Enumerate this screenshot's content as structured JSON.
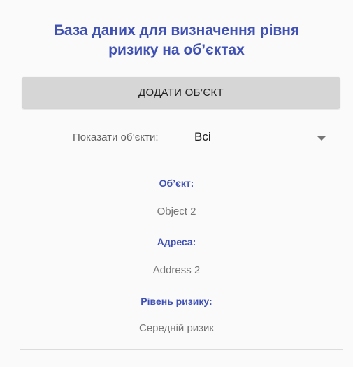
{
  "header": {
    "title": "База даних для визначення рівня ризику на об’єктах"
  },
  "actions": {
    "add_label": "ДОДАТИ ОБ’ЄКТ"
  },
  "filter": {
    "label": "Показати об’єкти:",
    "selected": "Всі",
    "icon": "dropdown-arrow-icon"
  },
  "record": {
    "object_label": "Об’єкт:",
    "object_value": "Object 2",
    "address_label": "Адреса:",
    "address_value": "Address 2",
    "risk_label": "Рівень ризику:",
    "risk_value": "Середній ризик"
  },
  "colors": {
    "accent": "#3f51b5",
    "button_bg": "#d6d6d6",
    "background": "#fafafa"
  }
}
